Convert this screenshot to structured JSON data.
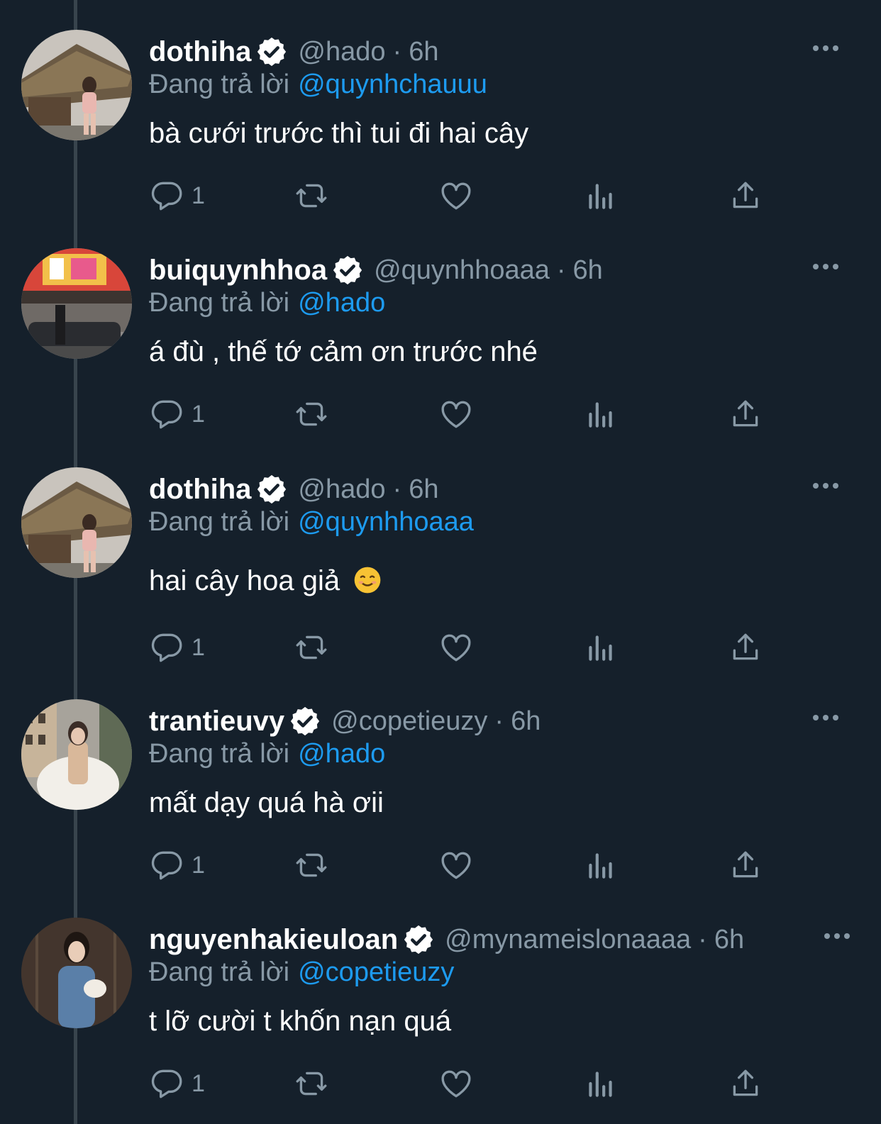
{
  "replying_label": "Đang trả lời",
  "tweets": [
    {
      "name": "dothiha",
      "handle": "@hado",
      "separator": "·",
      "time": "6h",
      "replying_to": "@quynhchauuu",
      "text": "bà cưới trước thì tui đi hai cây",
      "reply_count": "1"
    },
    {
      "name": "buiquynhhoa",
      "handle": "@quynhhoaaa",
      "separator": "·",
      "time": "6h",
      "replying_to": "@hado",
      "text": "á đù , thế tớ cảm ơn trước nhé",
      "reply_count": "1"
    },
    {
      "name": "dothiha",
      "handle": "@hado",
      "separator": "·",
      "time": "6h",
      "replying_to": "@quynhhoaaa",
      "text": "hai cây hoa giả",
      "emoji": "☺️",
      "reply_count": "1"
    },
    {
      "name": "trantieuvy",
      "handle": "@copetieuzy",
      "separator": "·",
      "time": "6h",
      "replying_to": "@hado",
      "text": "mất dạy quá hà ơii",
      "reply_count": "1"
    },
    {
      "name": "nguyenhakieuloan",
      "handle": "@mynameislonaaaa",
      "separator": "·",
      "time": "6h",
      "replying_to": "@copetieuzy",
      "text": "t lỡ cười t khốn nạn quá",
      "reply_count": "1"
    }
  ],
  "colors": {
    "background": "#15202b",
    "muted": "#8899a6",
    "link": "#1d9bf0",
    "thread_line": "#38444d"
  },
  "icons": [
    "verified-badge-icon",
    "more-icon",
    "reply-icon",
    "retweet-icon",
    "like-icon",
    "views-icon",
    "share-icon"
  ]
}
